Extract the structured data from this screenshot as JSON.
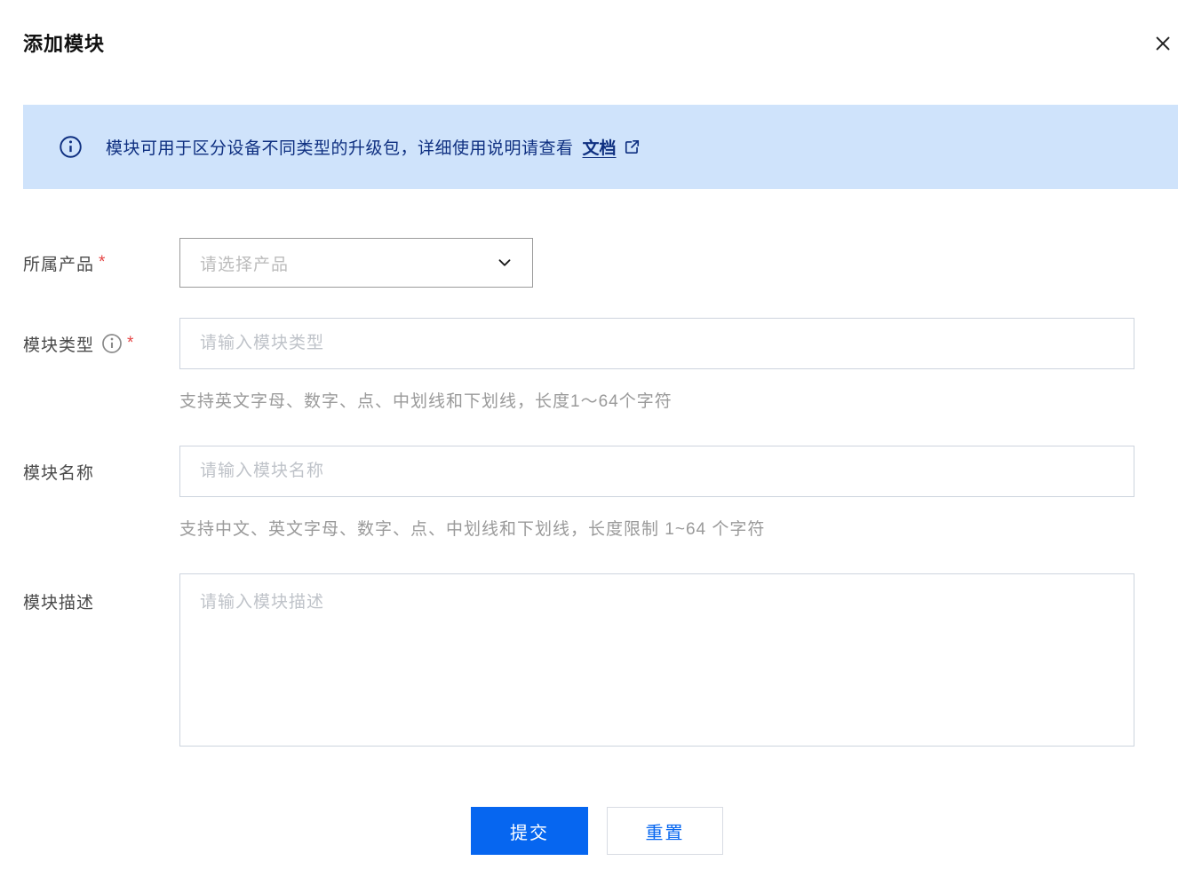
{
  "dialog": {
    "title": "添加模块"
  },
  "banner": {
    "text": "模块可用于区分设备不同类型的升级包，详细使用说明请查看",
    "link_text": "文档",
    "info_icon": "info-circle-icon",
    "link_icon": "external-link-icon"
  },
  "form": {
    "product": {
      "label": "所属产品",
      "required_mark": "*",
      "placeholder": "请选择产品",
      "dropdown_icon": "chevron-down-icon"
    },
    "module_type": {
      "label": "模块类型",
      "required_mark": "*",
      "info_icon": "info-circle-icon",
      "placeholder": "请输入模块类型",
      "hint": "支持英文字母、数字、点、中划线和下划线，长度1～64个字符"
    },
    "module_name": {
      "label": "模块名称",
      "placeholder": "请输入模块名称",
      "hint": "支持中文、英文字母、数字、点、中划线和下划线，长度限制 1~64 个字符"
    },
    "module_desc": {
      "label": "模块描述",
      "placeholder": "请输入模块描述"
    }
  },
  "actions": {
    "submit_label": "提交",
    "reset_label": "重置"
  },
  "colors": {
    "accent_blue": "#0666f0",
    "banner_background": "#cfe3fb",
    "banner_text": "#0e2f80",
    "required_red": "#e54545",
    "hint_gray": "#9a9a9a",
    "input_border": "#cdd4de",
    "select_border": "#9b9b9b"
  }
}
